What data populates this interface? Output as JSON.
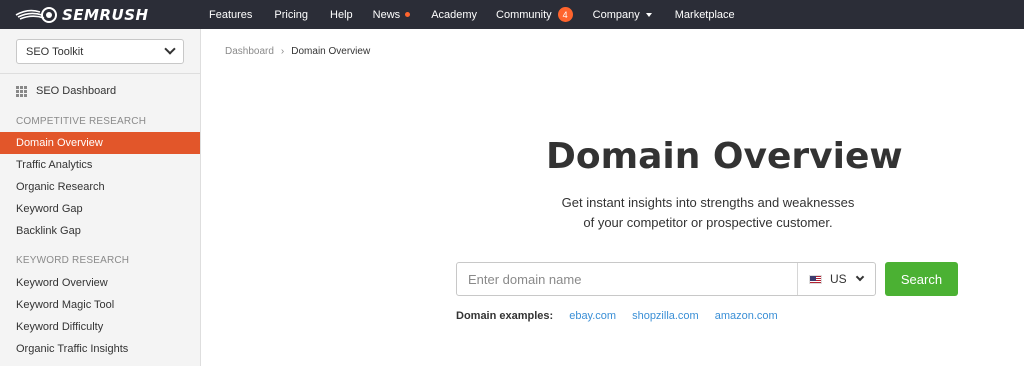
{
  "logo": {
    "text": "SEMRUSH",
    "icon": "semrush-flame-logo-icon"
  },
  "nav": {
    "features": "Features",
    "pricing": "Pricing",
    "help": "Help",
    "news": "News",
    "academy": "Academy",
    "community": "Community",
    "community_badge": "4",
    "company": "Company",
    "marketplace": "Marketplace"
  },
  "sidebar": {
    "toolkit": "SEO Toolkit",
    "dashboard": "SEO Dashboard",
    "competitive_heading": "COMPETITIVE RESEARCH",
    "competitive_items": [
      "Domain Overview",
      "Traffic Analytics",
      "Organic Research",
      "Keyword Gap",
      "Backlink Gap"
    ],
    "keyword_heading": "KEYWORD RESEARCH",
    "keyword_items": [
      "Keyword Overview",
      "Keyword Magic Tool",
      "Keyword Difficulty",
      "Organic Traffic Insights"
    ]
  },
  "breadcrumb": {
    "root": "Dashboard",
    "current": "Domain Overview"
  },
  "main": {
    "title": "Domain Overview",
    "subtitle_line1": "Get instant insights into strengths and weaknesses",
    "subtitle_line2": "of your competitor or prospective customer.",
    "search_placeholder": "Enter domain name",
    "database": "US",
    "search_button": "Search",
    "examples_label": "Domain examples:",
    "examples": [
      "ebay.com",
      "shopzilla.com",
      "amazon.com"
    ]
  },
  "colors": {
    "accent": "#e2562a",
    "nav_bg": "#2b2d37",
    "search_green": "#4bb133",
    "link": "#3a8fd6"
  }
}
